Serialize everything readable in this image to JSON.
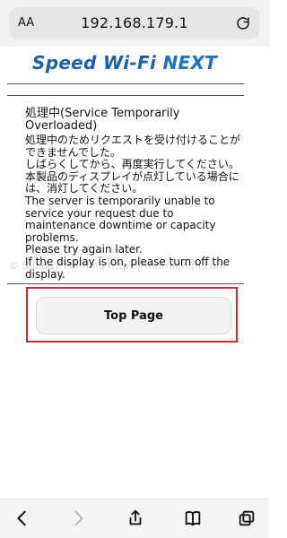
{
  "browser": {
    "font_size_button": "AA",
    "address": "192.168.179.1"
  },
  "brand": {
    "logo_text_1": "Speed",
    "logo_text_2": "Wi-Fi",
    "logo_text_3": "NEXT",
    "logo_color": "#1a5fb0"
  },
  "error": {
    "title": "処理中(Service Temporarily Overloaded)",
    "lines": [
      "処理中のためリクエストを受け付けることができませんでした。",
      "しばらくしてから、再度実行してください。",
      "本製品のディスプレイが点灯している場合には、消灯してください。",
      "The server is temporarily unable to service your request due to maintenance downtime or capacity problems.",
      "Please try again later.",
      "If the display is on, please turn off the display."
    ]
  },
  "actions": {
    "top_page_label": "Top Page",
    "highlight_color": "#d7252b"
  },
  "watermark": {
    "text": "© Sunday Morning  https://mhfractem.com"
  },
  "toolbar": {
    "icons": [
      "back-icon",
      "forward-icon",
      "share-icon",
      "bookmarks-icon",
      "tabs-icon"
    ]
  }
}
